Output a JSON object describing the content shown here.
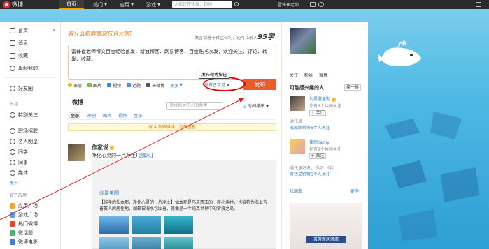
{
  "app": {
    "name": "微博"
  },
  "topnav": {
    "items": [
      {
        "label": "首页",
        "active": true,
        "dropdown": false
      },
      {
        "label": "热门",
        "active": false,
        "dropdown": true
      },
      {
        "label": "应用",
        "active": false,
        "dropdown": true
      },
      {
        "label": "游戏",
        "active": false,
        "dropdown": true
      }
    ],
    "search_placeholder": "大家正在热搜：奶妈",
    "username": "雷锋崔老师"
  },
  "sidebar": {
    "items": [
      {
        "label": "首页",
        "icon": "home-icon"
      },
      {
        "label": "消息",
        "icon": "message-icon"
      },
      {
        "label": "收藏",
        "icon": "star-icon"
      },
      {
        "label": "发起我的",
        "icon": "coin-icon"
      }
    ],
    "friends_circle": "好友圈",
    "group_header": "分组",
    "groups": [
      {
        "label": "特别关注"
      },
      {
        "label": "职场招聘"
      },
      {
        "label": "名人明星"
      },
      {
        "label": "同学"
      },
      {
        "label": "同事"
      },
      {
        "label": "媒体"
      }
    ],
    "expand": "展开",
    "apps_header": "官方应用",
    "apps": [
      {
        "label": "应用广场"
      },
      {
        "label": "游戏广场"
      },
      {
        "label": "热门微博"
      },
      {
        "label": "微话题"
      },
      {
        "label": "微博电影"
      }
    ]
  },
  "composer": {
    "prompt": "有什么新鲜事想告诉大家?",
    "notice_text": "发言请遵守社区公约，还可以输入",
    "remaining": "95字",
    "text": "雷锋崔老师博文百度经验首发，新浪博客、网易博客、百度贴吧次发，欢迎关注、评论、转发、收藏。",
    "tools": [
      {
        "label": "表情",
        "color": "#f4b400"
      },
      {
        "label": "图片",
        "color": "#6fbf4a"
      },
      {
        "label": "视频",
        "color": "#3a8ad6"
      },
      {
        "label": "话题",
        "color": "#4a90d9"
      },
      {
        "label": "长微博",
        "color": "#555555"
      }
    ],
    "more": "更多",
    "visibility": "仅自己可见",
    "publish": "发布",
    "tooltip": "发布微博按钮"
  },
  "feed": {
    "title": "微博",
    "search_placeholder": "查找我关注人的微博",
    "sort": "时间排序",
    "tabs": [
      "全部",
      "原创",
      "图片",
      "视频",
      "音乐"
    ],
    "new_notice": "有 4 条新微博，点击查看",
    "post": {
      "author": "作家说",
      "text": "净化心灵的一片净土!",
      "emoji": "[微风]",
      "repost_author": "@最美图",
      "repost_text": "【纯净的仙本那，净化心灵的一片净土】仙本那是马来西亚的一座小渔村，也被称为海上吉普赛人的居住地，蝴蝶被海水包围着，就像是一个纯真世界中的梦境之岛。"
    }
  },
  "right": {
    "stats": [
      "关注",
      "粉丝",
      "微博"
    ],
    "section_title": "可能感兴趣的人",
    "refresh": "换一换",
    "users": [
      {
        "name": "刘昊澄童鞋",
        "fans": "你有8个共同关注",
        "follow": "+ 关注"
      },
      {
        "name": "律师cathy",
        "fans": "你有8个共同关注",
        "follow": "+ 关注"
      }
    ],
    "meta1": {
      "prefix": "通讯录",
      "link": "戚戚顺佛等5个人关注"
    },
    "meta2": {
      "prefix": "通讯录好友，作品：《我...",
      "link": "有钱又帅等5个人关注"
    },
    "find_friends": "找朋友",
    "more": "更多",
    "ad_text": "茶芳新居酒店"
  }
}
